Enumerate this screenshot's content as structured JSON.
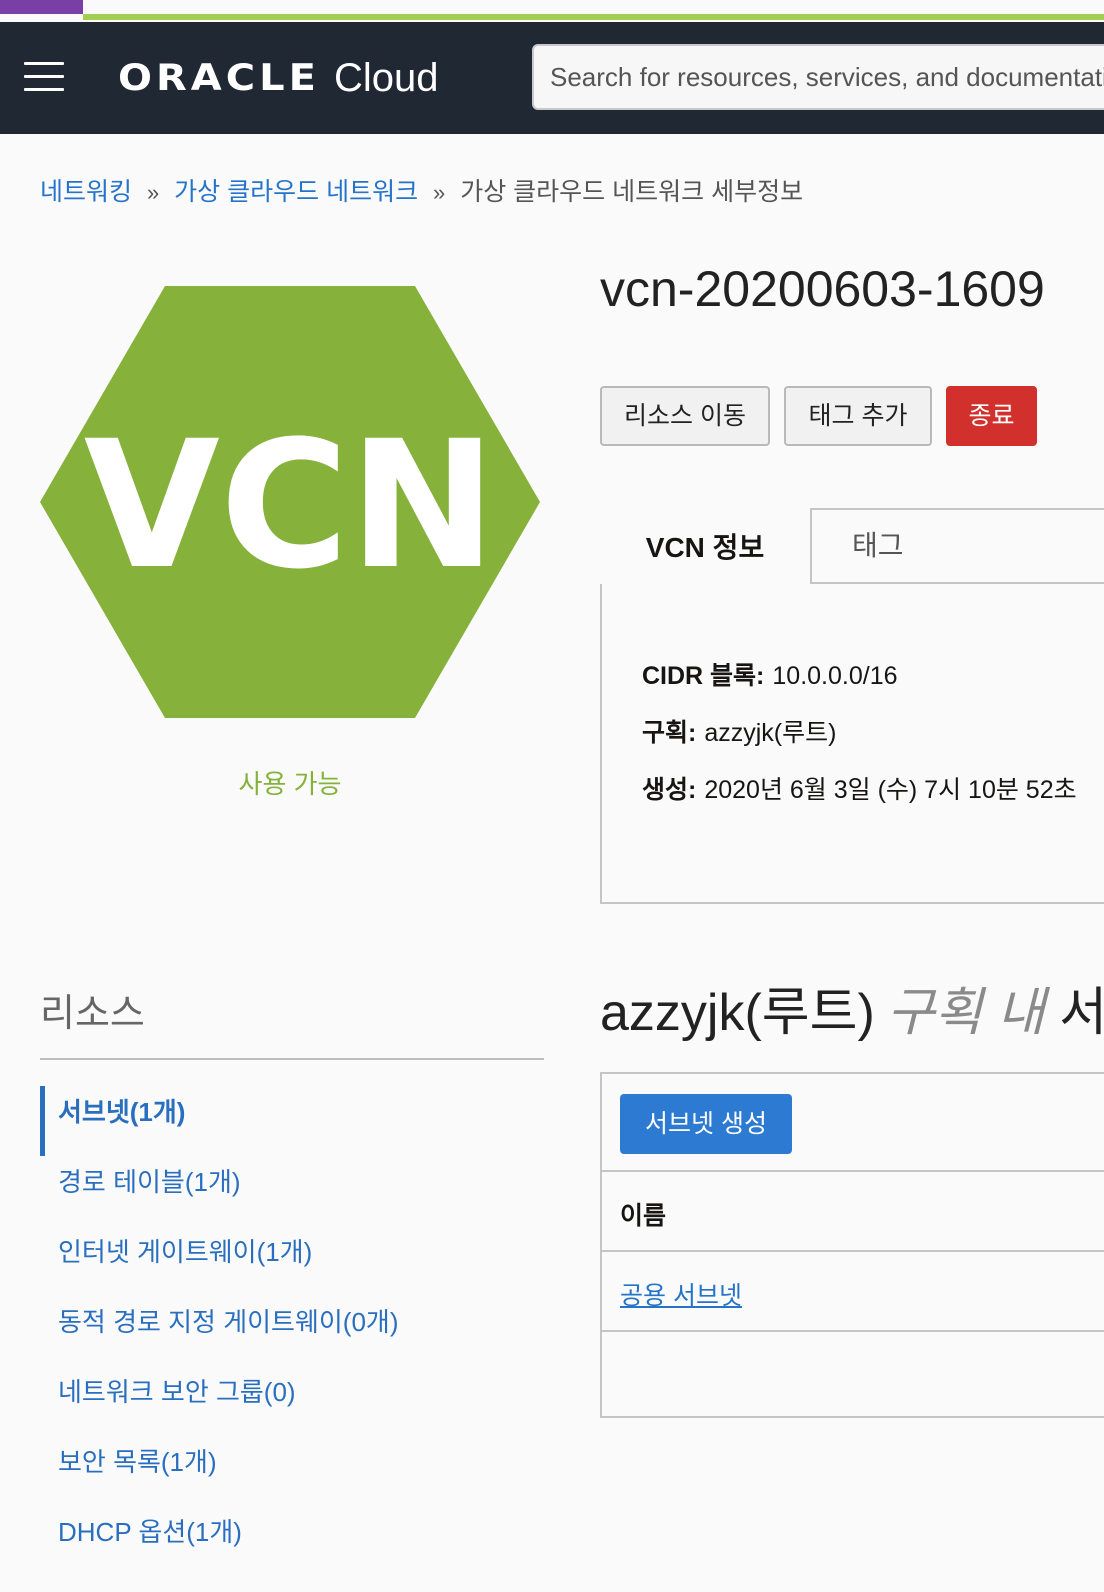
{
  "header": {
    "brand_oracle": "ORACLE",
    "brand_cloud": "Cloud",
    "search_placeholder": "Search for resources, services, and documentation",
    "menu_icon": "hamburger-menu-icon"
  },
  "breadcrumb": {
    "items": [
      "네트워킹",
      "가상 클라우드 네트워크"
    ],
    "separator": "»",
    "current": "가상 클라우드 네트워크 세부정보"
  },
  "vcn": {
    "badge_text": "VCN",
    "badge_color": "#86b23b",
    "status": "사용 가능",
    "title": "vcn-20200603-1609"
  },
  "actions": {
    "move_resource": "리소스 이동",
    "add_tag": "태그 추가",
    "terminate": "종료"
  },
  "tabs": {
    "info": "VCN 정보",
    "tags": "태그"
  },
  "info": {
    "cidr_label": "CIDR 블록:",
    "cidr_value": "10.0.0.0/16",
    "compartment_label": "구획:",
    "compartment_value": "azzyjk(루트)",
    "created_label": "생성:",
    "created_value": "2020년 6월 3일 (수) 7시 10분 52초"
  },
  "resources": {
    "title": "리소스",
    "items": [
      "서브넷(1개)",
      "경로 테이블(1개)",
      "인터넷 게이트웨이(1개)",
      "동적 경로 지정 게이트웨이(0개)",
      "네트워크 보안 그룹(0)",
      "보안 목록(1개)",
      "DHCP 옵션(1개)"
    ]
  },
  "subnets": {
    "heading_main": "azzyjk(루트)",
    "heading_italic": "구획 내",
    "heading_tail": "서",
    "create_button": "서브넷 생성",
    "column_name": "이름",
    "rows": [
      "공용 서브넷"
    ]
  },
  "colors": {
    "accent_blue": "#2574c9",
    "danger_red": "#d1302d",
    "header_bg": "#1f2833"
  }
}
